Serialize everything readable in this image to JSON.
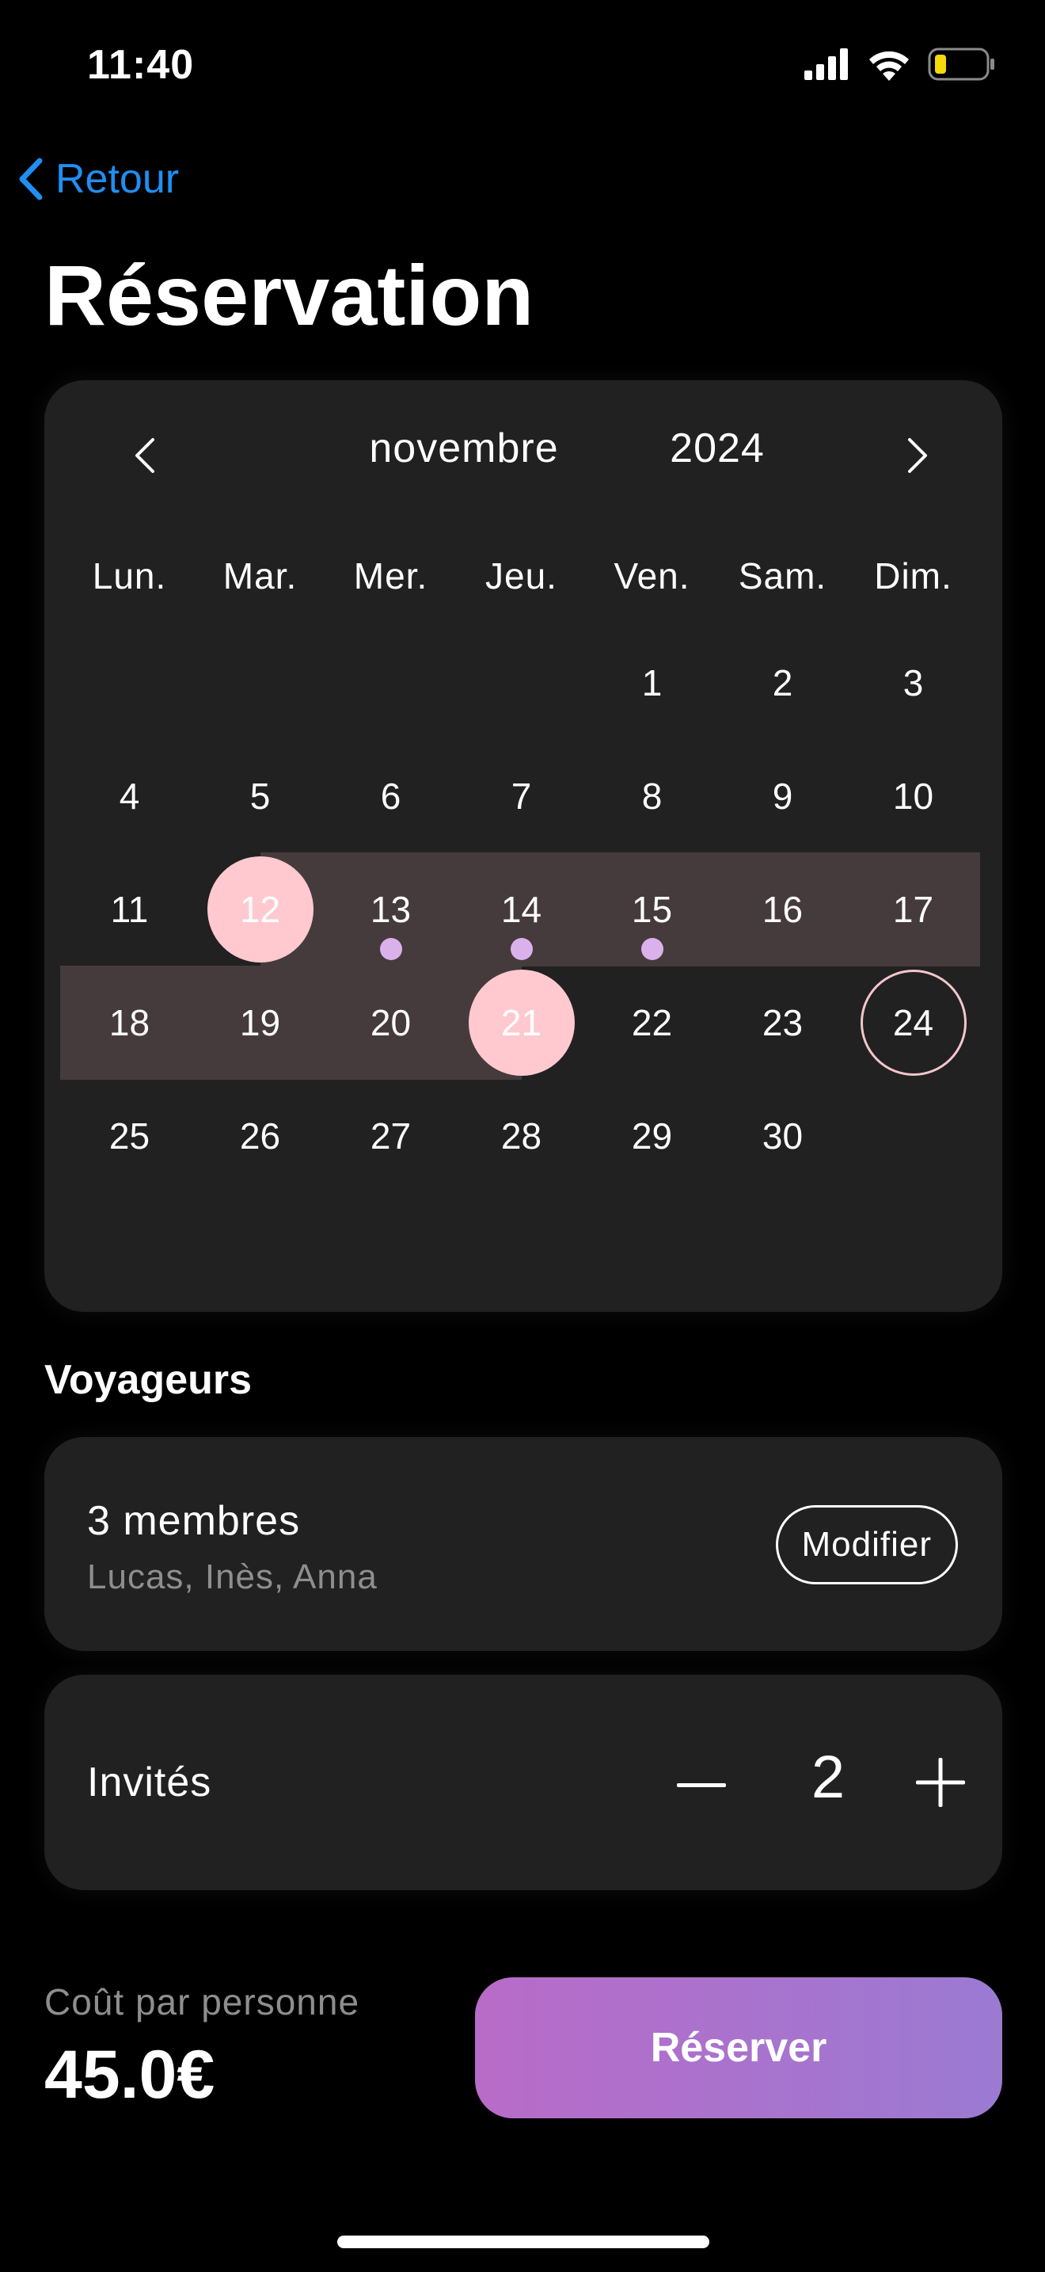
{
  "status_bar": {
    "time": "11:40"
  },
  "nav": {
    "back_label": "Retour"
  },
  "title": "Réservation",
  "calendar": {
    "month": "novembre",
    "year": "2024",
    "weekdays": [
      "Lun.",
      "Mar.",
      "Mer.",
      "Jeu.",
      "Ven.",
      "Sam.",
      "Dim."
    ],
    "days": [
      "1",
      "2",
      "3",
      "4",
      "5",
      "6",
      "7",
      "8",
      "9",
      "10",
      "11",
      "12",
      "13",
      "14",
      "15",
      "16",
      "17",
      "18",
      "19",
      "20",
      "21",
      "22",
      "23",
      "24",
      "25",
      "26",
      "27",
      "28",
      "29",
      "30"
    ],
    "first_weekday_index": 4,
    "range_start": 12,
    "range_end": 21,
    "today": 24,
    "dotted_days": [
      13,
      14,
      15
    ],
    "colors": {
      "selected": "#ffc9cf",
      "range": "#463b3c",
      "dot": "#dbb1ec",
      "today_ring": "#f3c6cb"
    }
  },
  "travellers": {
    "section_title": "Voyageurs",
    "members_count": "3 membres",
    "members_names": "Lucas, Inès, Anna",
    "modify_label": "Modifier"
  },
  "guests": {
    "label": "Invités",
    "value": "2"
  },
  "footer": {
    "cost_label": "Coût par personne",
    "cost_value": "45.0€",
    "reserve_label": "Réserver",
    "button_gradient": [
      "#b86bc8",
      "#9b7ad2"
    ]
  }
}
